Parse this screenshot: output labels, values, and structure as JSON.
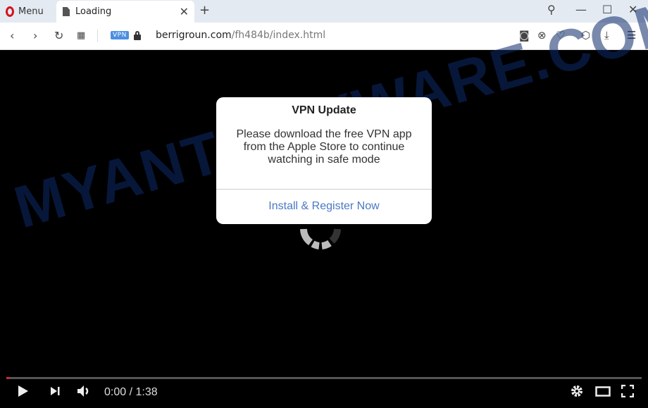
{
  "browser": {
    "menu_label": "Menu",
    "tab_title": "Loading",
    "url_domain": "berrigroun.com",
    "url_path": "/fh484b/index.html",
    "vpn_badge": "VPN"
  },
  "watermark": "MYANTISPYWARE.COM",
  "dialog": {
    "title": "VPN Update",
    "message": "Please download the free VPN app from the Apple Store to continue watching in safe mode",
    "button": "Install & Register Now"
  },
  "player": {
    "time": "0:00 / 1:38",
    "progress_fraction": 0.0
  }
}
